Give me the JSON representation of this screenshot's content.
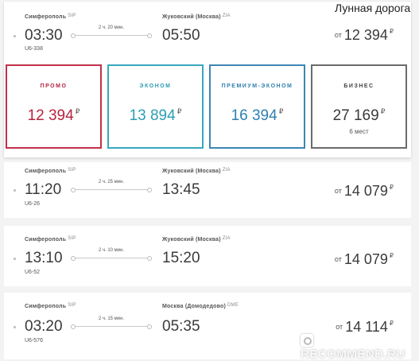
{
  "airline": {
    "name": "Лунная дорога"
  },
  "flights": [
    {
      "from_city": "Симферополь",
      "from_code": "SIP",
      "to_city": "Жуковский (Москва)",
      "to_code": "ZIA",
      "depart": "03:30",
      "arrive": "05:50",
      "duration": "2 ч. 20 мин.",
      "flight_number": "U6-338",
      "price_prefix": "от",
      "price": "12 394",
      "currency": "₽",
      "expanded": true,
      "fares": [
        {
          "label": "ПРОМО",
          "price": "12 394",
          "currency": "₽",
          "color": "#b5243f"
        },
        {
          "label": "ЭКОНОМ",
          "price": "13 894",
          "currency": "₽",
          "color": "#2c9eb3"
        },
        {
          "label": "ПРЕМИУМ-ЭКОНОМ",
          "price": "16 394",
          "currency": "₽",
          "color": "#2f7fb0"
        },
        {
          "label": "БИЗНЕС",
          "price": "27 169",
          "currency": "₽",
          "note": "6 мест",
          "color": "#444444"
        }
      ]
    },
    {
      "from_city": "Симферополь",
      "from_code": "SIP",
      "to_city": "Жуковский (Москва)",
      "to_code": "ZIA",
      "depart": "11:20",
      "arrive": "13:45",
      "duration": "2 ч. 25 мин.",
      "flight_number": "U6-26",
      "price_prefix": "от",
      "price": "14 079",
      "currency": "₽"
    },
    {
      "from_city": "Симферополь",
      "from_code": "SIP",
      "to_city": "Жуковский (Москва)",
      "to_code": "ZIA",
      "depart": "13:10",
      "arrive": "15:20",
      "duration": "2 ч. 10 мин.",
      "flight_number": "U6-52",
      "price_prefix": "от",
      "price": "14 079",
      "currency": "₽"
    },
    {
      "from_city": "Симферополь",
      "from_code": "SIP",
      "to_city": "Москва (Домодедово)",
      "to_code": "DME",
      "depart": "03:20",
      "arrive": "05:35",
      "duration": "2 ч. 15 мин.",
      "flight_number": "U6-576",
      "price_prefix": "от",
      "price": "14 114",
      "currency": "₽"
    }
  ],
  "watermark": {
    "text": "RECOMMEND.RU",
    "icon": "otzovik-logo-icon"
  }
}
